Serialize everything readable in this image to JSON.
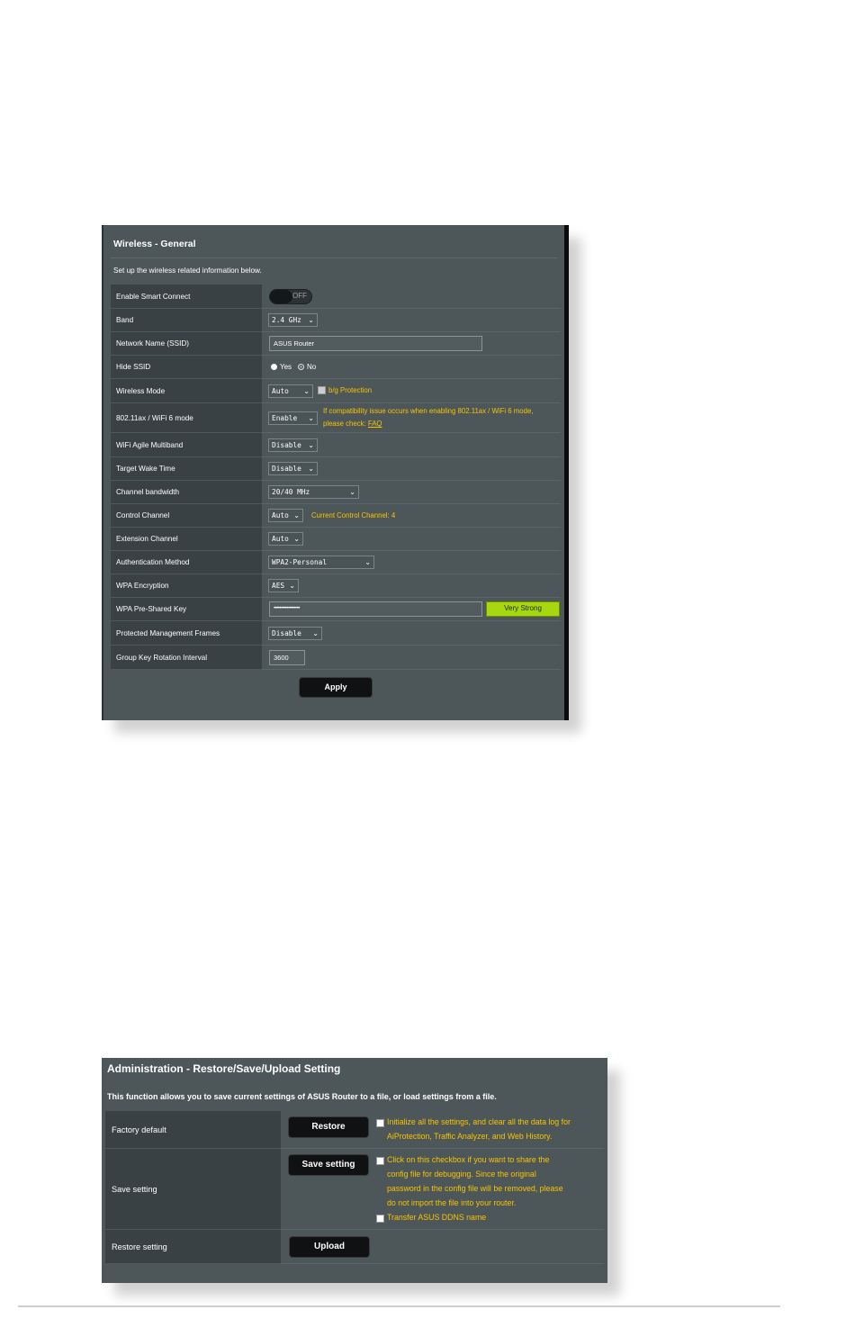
{
  "wireless": {
    "title": "Wireless - General",
    "description": "Set up the wireless related information below.",
    "rows": {
      "smart_connect": {
        "label": "Enable Smart Connect",
        "toggle": "OFF"
      },
      "band": {
        "label": "Band",
        "value": "2.4 GHz"
      },
      "ssid": {
        "label": "Network Name (SSID)",
        "value": "ASUS Router"
      },
      "hide_ssid": {
        "label": "Hide SSID",
        "opt_yes": "Yes",
        "opt_no": "No",
        "selected": "No"
      },
      "wireless_mode": {
        "label": "Wireless Mode",
        "value": "Auto",
        "checkbox_label": "b/g Protection"
      },
      "wifi6": {
        "label": "802.11ax / WiFi 6 mode",
        "value": "Enable",
        "note_line1": "If compatibility issue occurs when enabling 802.11ax / WiFi 6 mode,",
        "note_line2": "please check:",
        "note_link": "FAQ"
      },
      "agile": {
        "label": "WiFi Agile Multiband",
        "value": "Disable"
      },
      "twt": {
        "label": "Target Wake Time",
        "value": "Disable"
      },
      "bandwidth": {
        "label": "Channel bandwidth",
        "value": "20/40 MHz"
      },
      "control_channel": {
        "label": "Control Channel",
        "value": "Auto",
        "note": "Current Control Channel: 4"
      },
      "extension_channel": {
        "label": "Extension Channel",
        "value": "Auto"
      },
      "auth": {
        "label": "Authentication Method",
        "value": "WPA2-Personal"
      },
      "encryption": {
        "label": "WPA Encryption",
        "value": "AES"
      },
      "psk": {
        "label": "WPA Pre-Shared Key",
        "value": "••••••••••••••••••",
        "strength": "Very Strong"
      },
      "pmf": {
        "label": "Protected Management Frames",
        "value": "Disable"
      },
      "gkri": {
        "label": "Group Key Rotation Interval",
        "value": "3600"
      }
    },
    "apply_label": "Apply"
  },
  "admin": {
    "title": "Administration - Restore/Save/Upload Setting",
    "description": "This function allows you to save current settings of ASUS Router to a file, or load settings from a file.",
    "factory": {
      "label": "Factory default",
      "button": "Restore",
      "note_line1": "Initialize all the settings, and clear all the data log for",
      "note_line2": "AiProtection, Traffic Analyzer, and Web History."
    },
    "save": {
      "label": "Save setting",
      "button": "Save setting",
      "note_line1": "Click on this checkbox if you want to share the",
      "note_line2": "config file for debugging. Since the original",
      "note_line3": "password in the config file will be removed, please",
      "note_line4": "do not import the file into your router.",
      "ddns_label": "Transfer ASUS DDNS name"
    },
    "restore": {
      "label": "Restore setting",
      "button": "Upload"
    }
  },
  "colors": {
    "panel_bg": "#4d5659",
    "label_bg": "#3a4144",
    "note": "#f7c500",
    "strength": "#a7d80f"
  }
}
